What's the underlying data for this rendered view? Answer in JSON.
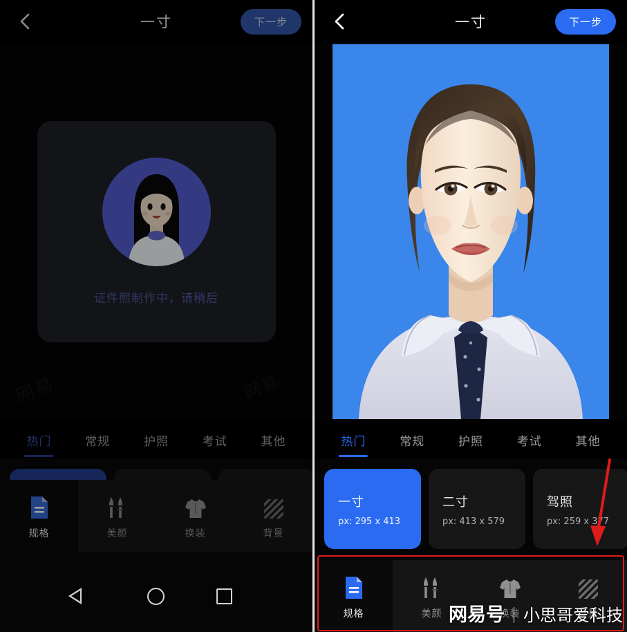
{
  "app": {
    "header": {
      "back_icon": "chevron-left-icon",
      "title": "一寸",
      "next_label": "下一步"
    },
    "tabs": [
      {
        "label": "热门",
        "active": true
      },
      {
        "label": "常规",
        "active": false
      },
      {
        "label": "护照",
        "active": false
      },
      {
        "label": "考试",
        "active": false
      },
      {
        "label": "其他",
        "active": false
      }
    ],
    "size_cards": [
      {
        "title": "一寸",
        "spec": "px: 295 x 413",
        "selected": true
      },
      {
        "title": "二寸",
        "spec": "px: 413 x 579",
        "selected": false
      },
      {
        "title": "驾照",
        "spec": "px: 259 x 377",
        "selected": false
      }
    ],
    "toolbar": [
      {
        "label": "规格",
        "icon": "document-icon",
        "active": true
      },
      {
        "label": "美颜",
        "icon": "beauty-brush-icon",
        "active": false
      },
      {
        "label": "换装",
        "icon": "tshirt-icon",
        "active": false
      },
      {
        "label": "背景",
        "icon": "hatch-pattern-icon",
        "active": false
      }
    ],
    "navbar": {
      "back_icon": "triangle-back-icon",
      "home_icon": "circle-home-icon",
      "recents_icon": "square-recents-icon"
    }
  },
  "left_panel": {
    "state": "loading",
    "loading_text": "证件照制作中，请稍后",
    "avatar_icon": "person-avatar-illustration",
    "bg_watermark": "网易",
    "bg_watermark2": "网易"
  },
  "right_panel": {
    "state": "result",
    "photo_alt": "id-photo-portrait",
    "annotation": {
      "highlight_box": "red-rectangle-around-toolbar",
      "arrow": "red-arrow-pointing-to-toolbar"
    },
    "watermark": {
      "brand": "网易号",
      "separator": "｜",
      "name": "小思哥爱科技"
    }
  },
  "colors": {
    "accent_blue": "#2a6bf2",
    "photo_background": "#3a86ea",
    "annotation_red": "#e01b1b",
    "card_dark": "#171717",
    "panel_black": "#000000"
  }
}
